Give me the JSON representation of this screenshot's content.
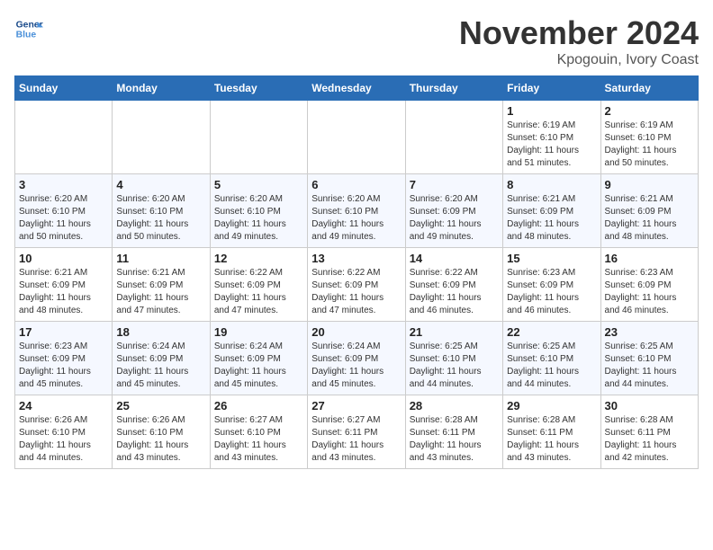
{
  "header": {
    "logo_line1": "General",
    "logo_line2": "Blue",
    "month_title": "November 2024",
    "location": "Kpogouin, Ivory Coast"
  },
  "weekdays": [
    "Sunday",
    "Monday",
    "Tuesday",
    "Wednesday",
    "Thursday",
    "Friday",
    "Saturday"
  ],
  "weeks": [
    [
      {
        "day": "",
        "info": ""
      },
      {
        "day": "",
        "info": ""
      },
      {
        "day": "",
        "info": ""
      },
      {
        "day": "",
        "info": ""
      },
      {
        "day": "",
        "info": ""
      },
      {
        "day": "1",
        "info": "Sunrise: 6:19 AM\nSunset: 6:10 PM\nDaylight: 11 hours\nand 51 minutes."
      },
      {
        "day": "2",
        "info": "Sunrise: 6:19 AM\nSunset: 6:10 PM\nDaylight: 11 hours\nand 50 minutes."
      }
    ],
    [
      {
        "day": "3",
        "info": "Sunrise: 6:20 AM\nSunset: 6:10 PM\nDaylight: 11 hours\nand 50 minutes."
      },
      {
        "day": "4",
        "info": "Sunrise: 6:20 AM\nSunset: 6:10 PM\nDaylight: 11 hours\nand 50 minutes."
      },
      {
        "day": "5",
        "info": "Sunrise: 6:20 AM\nSunset: 6:10 PM\nDaylight: 11 hours\nand 49 minutes."
      },
      {
        "day": "6",
        "info": "Sunrise: 6:20 AM\nSunset: 6:10 PM\nDaylight: 11 hours\nand 49 minutes."
      },
      {
        "day": "7",
        "info": "Sunrise: 6:20 AM\nSunset: 6:09 PM\nDaylight: 11 hours\nand 49 minutes."
      },
      {
        "day": "8",
        "info": "Sunrise: 6:21 AM\nSunset: 6:09 PM\nDaylight: 11 hours\nand 48 minutes."
      },
      {
        "day": "9",
        "info": "Sunrise: 6:21 AM\nSunset: 6:09 PM\nDaylight: 11 hours\nand 48 minutes."
      }
    ],
    [
      {
        "day": "10",
        "info": "Sunrise: 6:21 AM\nSunset: 6:09 PM\nDaylight: 11 hours\nand 48 minutes."
      },
      {
        "day": "11",
        "info": "Sunrise: 6:21 AM\nSunset: 6:09 PM\nDaylight: 11 hours\nand 47 minutes."
      },
      {
        "day": "12",
        "info": "Sunrise: 6:22 AM\nSunset: 6:09 PM\nDaylight: 11 hours\nand 47 minutes."
      },
      {
        "day": "13",
        "info": "Sunrise: 6:22 AM\nSunset: 6:09 PM\nDaylight: 11 hours\nand 47 minutes."
      },
      {
        "day": "14",
        "info": "Sunrise: 6:22 AM\nSunset: 6:09 PM\nDaylight: 11 hours\nand 46 minutes."
      },
      {
        "day": "15",
        "info": "Sunrise: 6:23 AM\nSunset: 6:09 PM\nDaylight: 11 hours\nand 46 minutes."
      },
      {
        "day": "16",
        "info": "Sunrise: 6:23 AM\nSunset: 6:09 PM\nDaylight: 11 hours\nand 46 minutes."
      }
    ],
    [
      {
        "day": "17",
        "info": "Sunrise: 6:23 AM\nSunset: 6:09 PM\nDaylight: 11 hours\nand 45 minutes."
      },
      {
        "day": "18",
        "info": "Sunrise: 6:24 AM\nSunset: 6:09 PM\nDaylight: 11 hours\nand 45 minutes."
      },
      {
        "day": "19",
        "info": "Sunrise: 6:24 AM\nSunset: 6:09 PM\nDaylight: 11 hours\nand 45 minutes."
      },
      {
        "day": "20",
        "info": "Sunrise: 6:24 AM\nSunset: 6:09 PM\nDaylight: 11 hours\nand 45 minutes."
      },
      {
        "day": "21",
        "info": "Sunrise: 6:25 AM\nSunset: 6:10 PM\nDaylight: 11 hours\nand 44 minutes."
      },
      {
        "day": "22",
        "info": "Sunrise: 6:25 AM\nSunset: 6:10 PM\nDaylight: 11 hours\nand 44 minutes."
      },
      {
        "day": "23",
        "info": "Sunrise: 6:25 AM\nSunset: 6:10 PM\nDaylight: 11 hours\nand 44 minutes."
      }
    ],
    [
      {
        "day": "24",
        "info": "Sunrise: 6:26 AM\nSunset: 6:10 PM\nDaylight: 11 hours\nand 44 minutes."
      },
      {
        "day": "25",
        "info": "Sunrise: 6:26 AM\nSunset: 6:10 PM\nDaylight: 11 hours\nand 43 minutes."
      },
      {
        "day": "26",
        "info": "Sunrise: 6:27 AM\nSunset: 6:10 PM\nDaylight: 11 hours\nand 43 minutes."
      },
      {
        "day": "27",
        "info": "Sunrise: 6:27 AM\nSunset: 6:11 PM\nDaylight: 11 hours\nand 43 minutes."
      },
      {
        "day": "28",
        "info": "Sunrise: 6:28 AM\nSunset: 6:11 PM\nDaylight: 11 hours\nand 43 minutes."
      },
      {
        "day": "29",
        "info": "Sunrise: 6:28 AM\nSunset: 6:11 PM\nDaylight: 11 hours\nand 43 minutes."
      },
      {
        "day": "30",
        "info": "Sunrise: 6:28 AM\nSunset: 6:11 PM\nDaylight: 11 hours\nand 42 minutes."
      }
    ]
  ]
}
